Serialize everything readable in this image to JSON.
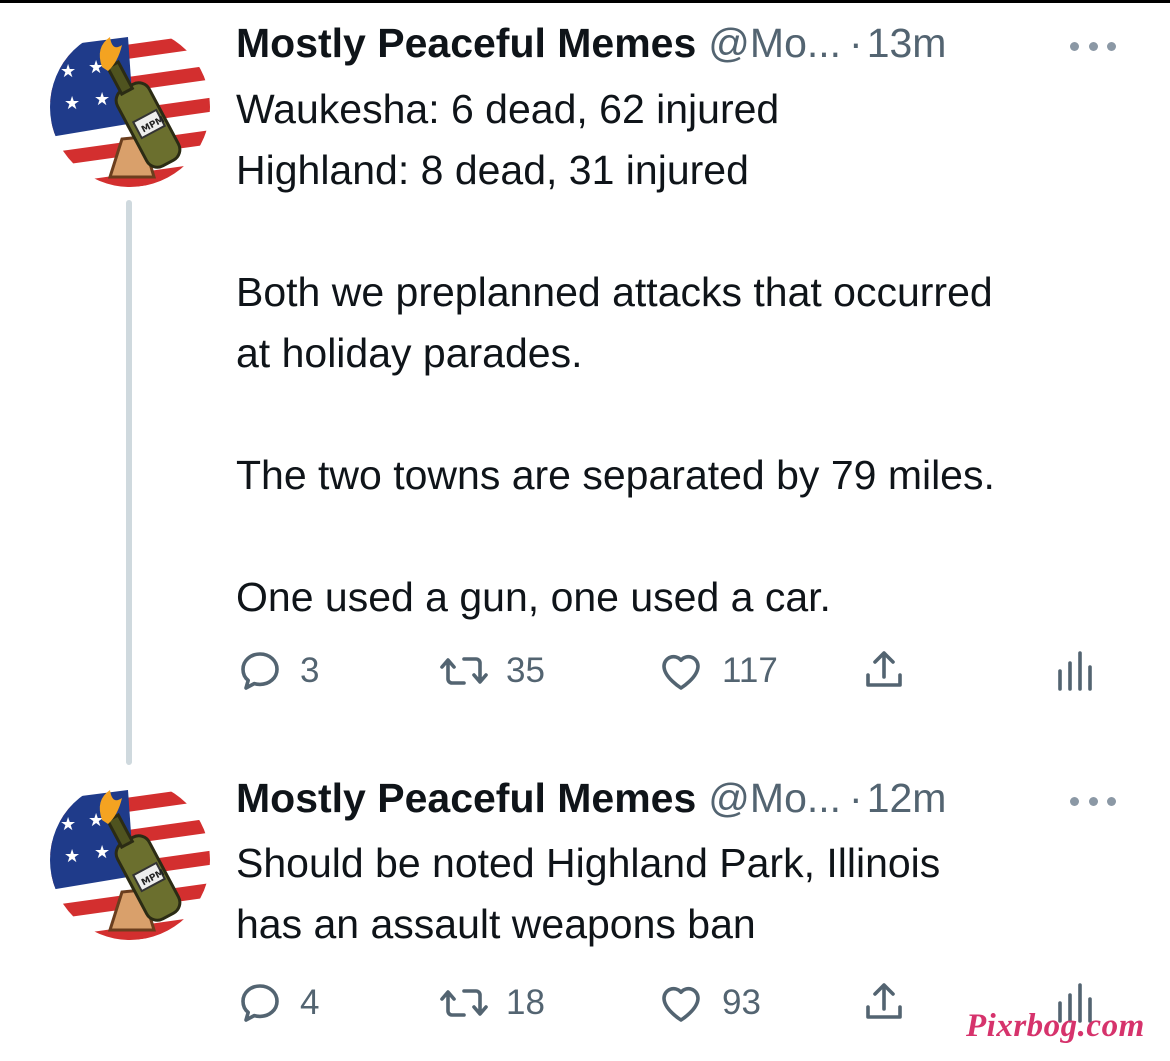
{
  "tweets": [
    {
      "author_name": "Mostly Peaceful Memes",
      "handle": "@Mo...",
      "separator": "·",
      "time": "13m",
      "avatar_icon": "mpm-flag-bottle-avatar",
      "avatar_label": "MPM",
      "lines": [
        "Waukesha: 6 dead, 62 injured",
        "Highland: 8 dead, 31 injured",
        "",
        "Both we preplanned attacks that occurred",
        "at holiday parades.",
        "",
        "The two towns are separated by 79 miles.",
        "",
        "One used a gun, one used a car."
      ],
      "replies": "3",
      "retweets": "35",
      "likes": "117"
    },
    {
      "author_name": "Mostly Peaceful Memes",
      "handle": "@Mo...",
      "separator": "·",
      "time": "12m",
      "avatar_icon": "mpm-flag-bottle-avatar",
      "avatar_label": "MPM",
      "lines": [
        "Should be noted Highland Park, Illinois",
        "has an assault weapons ban"
      ],
      "replies": "4",
      "retweets": "18",
      "likes": "93"
    }
  ],
  "watermark": "Pixrbog.com",
  "colors": {
    "text": "#0f1419",
    "secondary": "#536471",
    "thread_line": "#cfd9de",
    "watermark": "#d6336c"
  }
}
